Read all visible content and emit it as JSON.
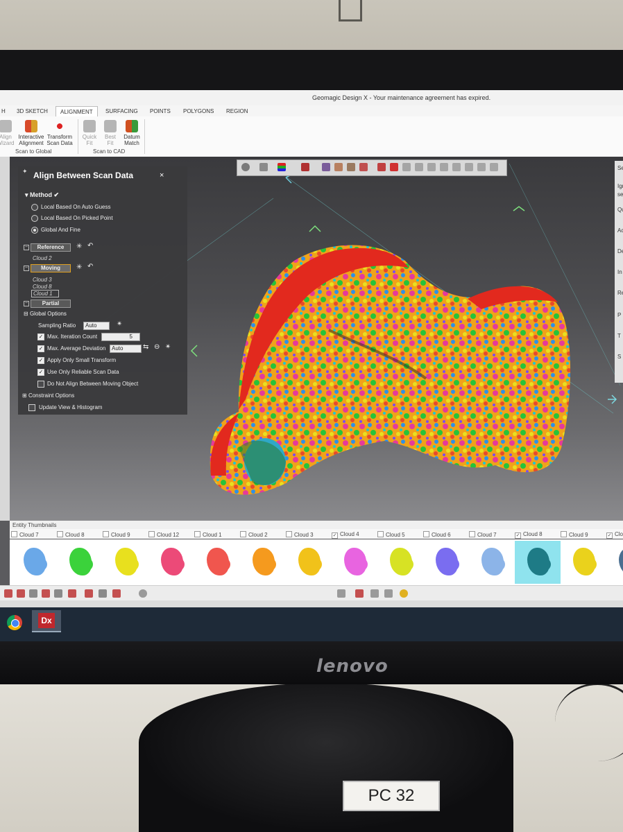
{
  "window_title": "Geomagic Design X - Your maintenance agreement has expired.",
  "tabs": [
    "H",
    "3D SKETCH",
    "ALIGNMENT",
    "SURFACING",
    "POINTS",
    "POLYGONS",
    "REGION"
  ],
  "ribbon": {
    "buttons": [
      {
        "label": "Align\nWizard",
        "dim": true
      },
      {
        "label": "Interactive\nAlignment",
        "dim": false
      },
      {
        "label": "Transform\nScan Data",
        "dim": false
      },
      {
        "label": "Quick\nFit",
        "dim": true
      },
      {
        "label": "Best\nFit",
        "dim": true
      },
      {
        "label": "Datum\nMatch",
        "dim": false
      }
    ],
    "groups": [
      "Scan to Global",
      "Scan to CAD"
    ]
  },
  "panel": {
    "title": "Align Between Scan Data",
    "close": "×",
    "method_label": "Method",
    "methods": [
      "Local Based On Auto Guess",
      "Local Based On Picked Point",
      "Global And Fine"
    ],
    "selected_method": "Global And Fine",
    "reference_label": "Reference",
    "reference_items": [
      "Cloud 2"
    ],
    "moving_label": "Moving",
    "moving_items": [
      "Cloud 3",
      "Cloud 8",
      "Cloud 1"
    ],
    "partial_label": "Partial",
    "global_options_label": "Global Options",
    "sampling_ratio_label": "Sampling Ratio",
    "sampling_ratio_value": "Auto",
    "max_iteration_label": "Max. Iteration Count",
    "max_iteration_value": "5",
    "max_avg_dev_label": "Max. Average Deviation",
    "max_avg_dev_value": "Auto",
    "apply_small_label": "Apply Only Small Transform",
    "reliable_label": "Use Only Reliable Scan Data",
    "no_align_label": "Do Not Align Between Moving Object",
    "constraint_label": "Constraint Options",
    "update_view_label": "Update View & Histogram"
  },
  "right_strip": [
    "Sel",
    "Ign",
    "se",
    "Qu",
    "Ac",
    "De",
    "In",
    "Re",
    "P",
    "T",
    "S"
  ],
  "thumbnails": {
    "header": "Entity Thumbnails",
    "items": [
      {
        "name": "Cloud 7",
        "checked": false,
        "color": "#6aa8e8"
      },
      {
        "name": "Cloud 8",
        "checked": false,
        "color": "#3bd23b"
      },
      {
        "name": "Cloud 9",
        "checked": false,
        "color": "#e8e01e"
      },
      {
        "name": "Cloud 12",
        "checked": false,
        "color": "#ec4a78"
      },
      {
        "name": "Cloud 1",
        "checked": false,
        "color": "#f0564e"
      },
      {
        "name": "Cloud 2",
        "checked": false,
        "color": "#f59a1e"
      },
      {
        "name": "Cloud 3",
        "checked": false,
        "color": "#f1c21a"
      },
      {
        "name": "Cloud 4",
        "checked": true,
        "color": "#e864e0"
      },
      {
        "name": "Cloud 5",
        "checked": false,
        "color": "#d7e224"
      },
      {
        "name": "Cloud 6",
        "checked": false,
        "color": "#7a6df0"
      },
      {
        "name": "Cloud 7",
        "checked": false,
        "color": "#8cb4e8"
      },
      {
        "name": "Cloud 8",
        "checked": true,
        "color": "#1e7b86"
      },
      {
        "name": "Cloud 9",
        "checked": false,
        "color": "#ead21c"
      },
      {
        "name": "Clo",
        "checked": true,
        "color": "#4a6e90"
      }
    ]
  },
  "taskbar": {
    "app_label": "Dx"
  },
  "monitor": {
    "brand": "lenovo",
    "sticker": "PC 32"
  }
}
